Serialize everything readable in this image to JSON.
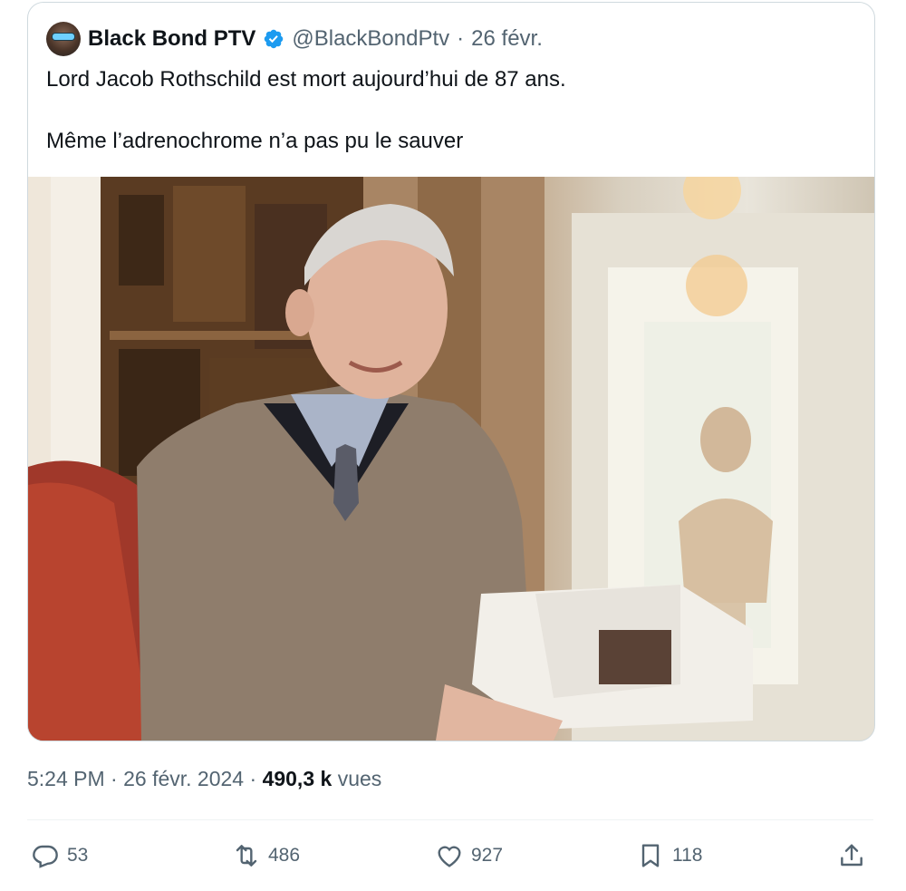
{
  "quoted_tweet": {
    "author_name": "Black Bond PTV",
    "handle": "@BlackBondPtv",
    "separator": "·",
    "date": "26 févr.",
    "text_line1": "Lord Jacob Rothschild est mort aujourd’hui de 87 ans.",
    "text_line2": "Même l’adrenochrome n’a pas pu le sauver",
    "verified_icon": "verified-badge-icon",
    "verified_color": "#1d9bf0"
  },
  "tweet_meta": {
    "time": "5:24 PM",
    "separator1": " · ",
    "date": "26 févr. 2024",
    "separator2": " · ",
    "views_count": "490,3 k",
    "views_label": "vues"
  },
  "actions": {
    "replies": {
      "icon": "reply-icon",
      "count": "53"
    },
    "retweets": {
      "icon": "retweet-icon",
      "count": "486"
    },
    "likes": {
      "icon": "heart-icon",
      "count": "927"
    },
    "bookmarks": {
      "icon": "bookmark-icon",
      "count": "118"
    },
    "share": {
      "icon": "share-icon"
    }
  },
  "colors": {
    "text_primary": "#0f1419",
    "text_secondary": "#536471",
    "border": "#cfd9de"
  }
}
